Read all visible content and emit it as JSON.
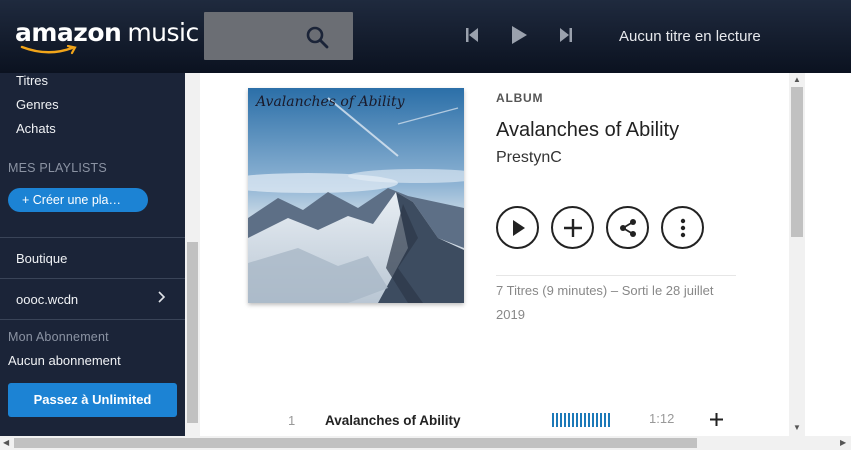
{
  "header": {
    "logo_part1": "amazon",
    "logo_part2": "music",
    "search_icon": "search-icon",
    "controls": [
      "previous-icon",
      "play-icon",
      "next-icon"
    ],
    "now_playing": "Aucun titre en lecture"
  },
  "sidebar": {
    "items": [
      "Titres",
      "Genres",
      "Achats"
    ],
    "playlists_heading": "MES PLAYLISTS",
    "create_playlist": "+ Créer une pla…",
    "store": "Boutique",
    "account": "oooc.wcdn",
    "subscription_heading": "Mon Abonnement",
    "subscription_status": "Aucun abonnement",
    "upgrade": "Passez à Unlimited"
  },
  "album": {
    "label": "ALBUM",
    "title": "Avalanches of Ability",
    "artist": "PrestynC",
    "cover_text": "Avalanches of Ability",
    "actions": [
      "play-icon",
      "add-icon",
      "share-icon",
      "more-icon"
    ],
    "meta_line1": "7 Titres (9 minutes)  –  Sorti le 28 juillet",
    "meta_line2": "2019"
  },
  "tracks": [
    {
      "number": "1",
      "title": "Avalanches of Ability",
      "duration": "1:12"
    }
  ],
  "colors": {
    "header_bg": "#1f2a3e",
    "sidebar_bg": "#1b2438",
    "accent": "#1c83d4",
    "progress_bars": "#1c79b8"
  }
}
